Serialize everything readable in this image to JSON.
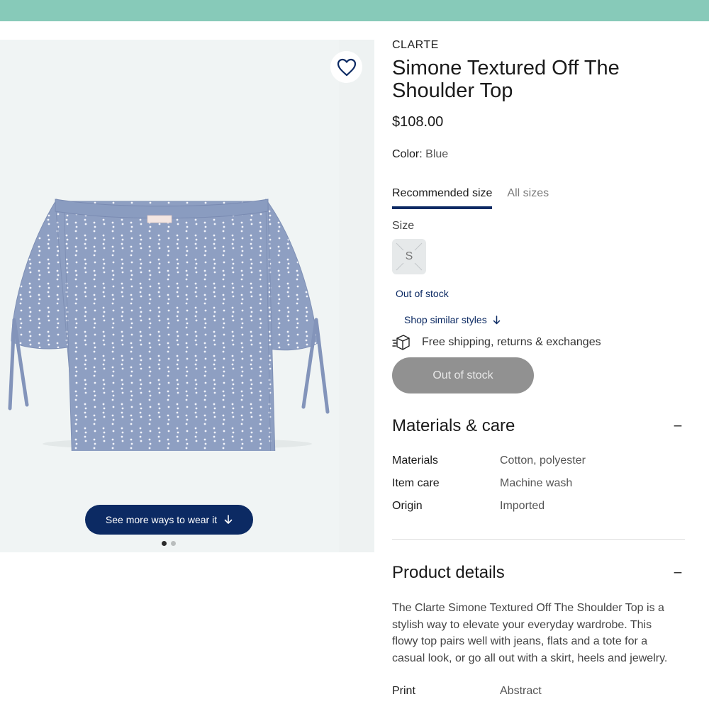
{
  "product": {
    "brand": "CLARTE",
    "title": "Simone Textured Off The Shoulder Top",
    "price": "$108.00",
    "color_label": "Color:",
    "color_value": "Blue"
  },
  "gallery": {
    "see_more_label": "See more ways to wear it",
    "image_count": 2,
    "active_image": 1
  },
  "size_tabs": [
    {
      "label": "Recommended size",
      "active": true
    },
    {
      "label": "All sizes",
      "active": false
    }
  ],
  "size": {
    "label": "Size",
    "options": [
      {
        "label": "S",
        "available": false
      }
    ],
    "status": "Out of stock"
  },
  "links": {
    "shop_similar": "Shop similar styles"
  },
  "shipping": {
    "text": "Free shipping, returns & exchanges"
  },
  "cta": {
    "label": "Out of stock",
    "disabled": true
  },
  "materials_care": {
    "heading": "Materials & care",
    "rows": [
      {
        "key": "Materials",
        "value": "Cotton, polyester"
      },
      {
        "key": "Item care",
        "value": "Machine wash"
      },
      {
        "key": "Origin",
        "value": "Imported"
      }
    ]
  },
  "product_details": {
    "heading": "Product details",
    "description": "The Clarte Simone Textured Off The Shoulder Top is a stylish way to elevate your everyday wardrobe. This flowy top pairs well with jeans, flats and a tote for a casual look, or go all out with a skirt, heels and jewelry.",
    "rows": [
      {
        "key": "Print",
        "value": "Abstract"
      }
    ]
  },
  "icons": {
    "favorite": "heart-icon",
    "see_more_arrow": "arrow-down-icon",
    "similar_arrow": "arrow-down-icon",
    "shipping": "box-icon",
    "collapse": "minus-icon"
  },
  "colors": {
    "banner": "#87cab9",
    "navy": "#0c2a63",
    "image_bg": "#f0f4f4",
    "disabled_button": "#919191",
    "garment": "#8e9fc2"
  }
}
